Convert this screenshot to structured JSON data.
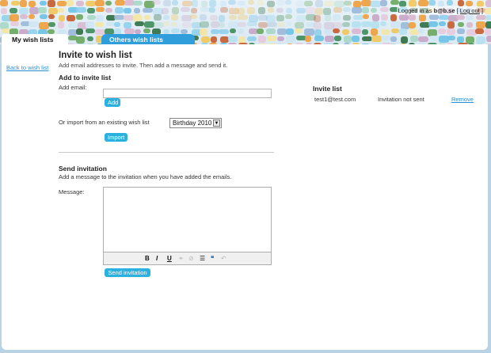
{
  "header": {
    "login_prefix": "Logged in as ",
    "login_user": "b@b.se",
    "login_bracket_open": " [ ",
    "logout_label": "Log out",
    "login_bracket_close": " ]"
  },
  "tabs": {
    "my_wish_lists": "My wish lists",
    "others_wish_lists": "Others wish lists"
  },
  "sidebar": {
    "back_link": "Back to wish list"
  },
  "main": {
    "title": "Invite to wish list",
    "description": "Add email addresses to invite. Then add a message and send it.",
    "add_section_title": "Add to invite list",
    "add_email_label": "Add email:",
    "add_email_value": "",
    "add_button": "Add",
    "import_label": "Or import from an existing wish list",
    "import_select_value": "Birthday 2010",
    "import_button": "Import",
    "send_section_title": "Send invitation",
    "send_description": "Add a message to the invitation when you have added the emails.",
    "message_label": "Message:",
    "message_value": "",
    "send_button": "Send invitation"
  },
  "invite_list": {
    "title": "Invite list",
    "items": [
      {
        "email": "test1@test.com",
        "status": "Invitation not sent",
        "action": "Remove"
      }
    ]
  },
  "colors": {
    "accent": "#2bb1e0",
    "tab_active_bg": "#2f9edb",
    "link": "#2a8fd1"
  }
}
